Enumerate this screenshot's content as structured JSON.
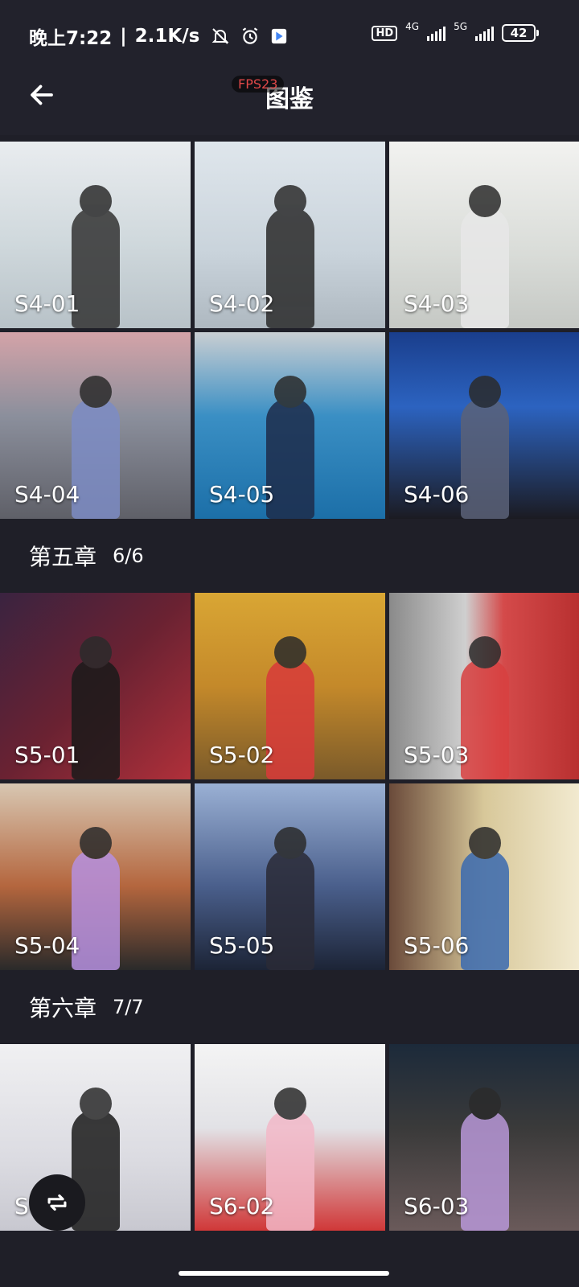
{
  "status_bar": {
    "time": "晚上7:22",
    "speed": "2.1K/s",
    "hd_label": "HD",
    "net1": "4G",
    "net2": "5G",
    "battery": "42"
  },
  "header": {
    "title": "图鉴",
    "fps": "FPS23"
  },
  "colors": {
    "background": "#1f1f28",
    "bar": "#22222c"
  },
  "sections": [
    {
      "title": "",
      "count": "",
      "tiles": [
        {
          "label": "S4-01",
          "bg": "linear-gradient(180deg,#e9ecef 0%,#cfd8dc 55%,#b8c2c8 100%)",
          "dress": "#333"
        },
        {
          "label": "S4-02",
          "bg": "linear-gradient(180deg,#dfe6ec 0%,#c9d3db 60%,#aeb8c0 100%)",
          "dress": "#2a2a2a"
        },
        {
          "label": "S4-03",
          "bg": "linear-gradient(180deg,#f2f2f0 0%,#d9dcd8 60%,#c5c8c4 100%)",
          "dress": "#e8e8e8"
        },
        {
          "label": "S4-04",
          "bg": "linear-gradient(180deg,#d4a3a8 0%,#8b8f9c 45%,#5f6068 100%)",
          "dress": "#7c8cc4"
        },
        {
          "label": "S4-05",
          "bg": "linear-gradient(180deg,#c9ced2 0%,#3a8fc4 45%,#1c6fa8 100%)",
          "dress": "#1d2b4a"
        },
        {
          "label": "S4-06",
          "bg": "linear-gradient(180deg,#1a3e8c 0%,#2c63c0 40%,#1b1b22 100%)",
          "dress": "#5a6278"
        }
      ]
    },
    {
      "title": "第五章",
      "count": "6/6",
      "tiles": [
        {
          "label": "S5-01",
          "bg": "linear-gradient(135deg,#3a2340 0%,#6a2232 50%,#b0303a 100%)",
          "dress": "#1a1a1a"
        },
        {
          "label": "S5-02",
          "bg": "linear-gradient(180deg,#d9a634 0%,#c4892a 50%,#7a5a2a 100%)",
          "dress": "#d83a3a"
        },
        {
          "label": "S5-03",
          "bg": "linear-gradient(90deg,#8a8a8a 0%,#cfcfcf 40%,#d44a4a 60%,#b83030 100%)",
          "dress": "#d84040"
        },
        {
          "label": "S5-04",
          "bg": "linear-gradient(180deg,#d8c7b2 0%,#b4663e 55%,#2a2a2a 100%)",
          "dress": "#b690e0"
        },
        {
          "label": "S5-05",
          "bg": "linear-gradient(180deg,#9ab0d4 0%,#4a5f8c 55%,#1c2436 100%)",
          "dress": "#2a2a36"
        },
        {
          "label": "S5-06",
          "bg": "linear-gradient(90deg,#6a4a3a 0%,#d8c89a 50%,#f2ead0 100%)",
          "dress": "#3a6ab0"
        }
      ]
    },
    {
      "title": "第六章",
      "count": "7/7",
      "tiles": [
        {
          "label": "S6-01",
          "bg": "linear-gradient(180deg,#f0f0f2 0%,#dcdce2 60%,#c8c8d0 100%)",
          "dress": "#1a1a1a"
        },
        {
          "label": "S6-02",
          "bg": "linear-gradient(180deg,#f4f4f4 0%,#e2e2e6 45%,#d03838 100%)",
          "dress": "#f2b8c8"
        },
        {
          "label": "S6-03",
          "bg": "linear-gradient(180deg,#1c2a3a 0%,#3a3a3a 45%,#6a5a5a 100%)",
          "dress": "#b898d8"
        }
      ]
    }
  ],
  "icons": {
    "back": "arrow-left-icon",
    "fab": "swap-icon"
  }
}
